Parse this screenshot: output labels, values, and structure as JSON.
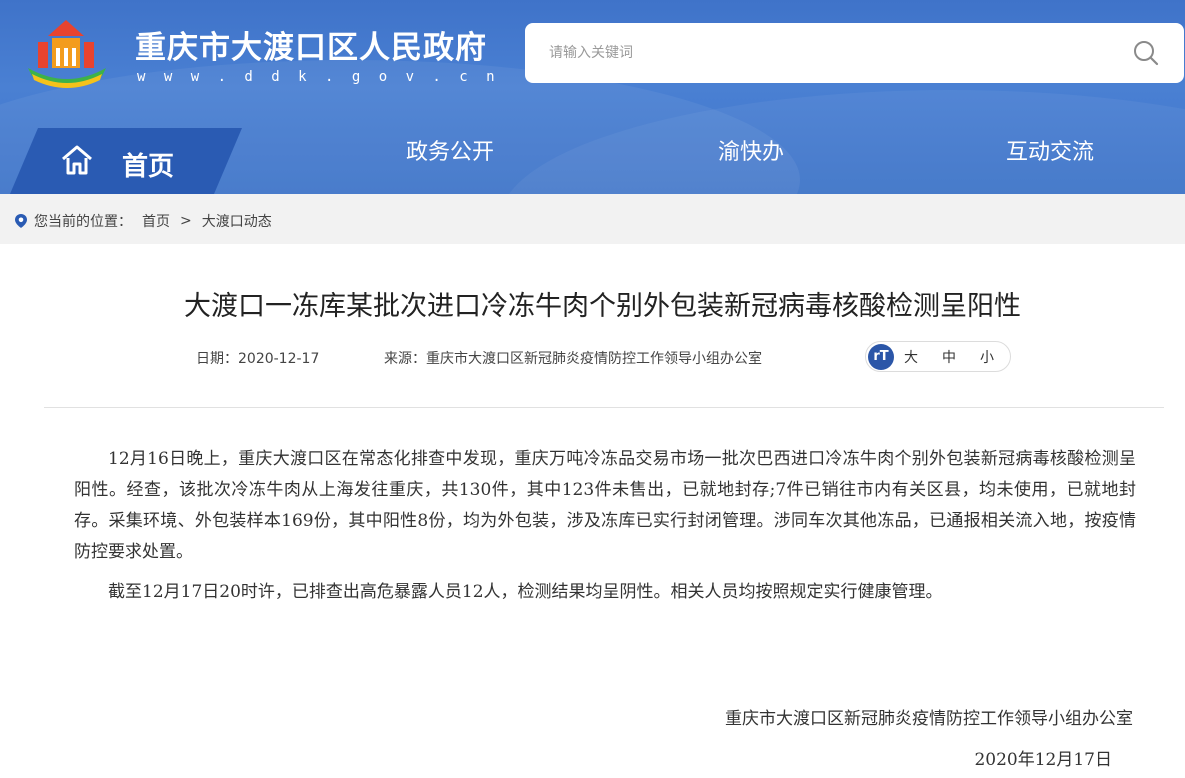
{
  "header": {
    "site_title": "重庆市大渡口区人民政府",
    "site_url": "w w w . d d k . g o v . c n",
    "search_placeholder": "请输入关键词"
  },
  "nav": {
    "home": "首页",
    "items": [
      "政务公开",
      "渝快办",
      "互动交流"
    ]
  },
  "breadcrumb": {
    "prefix": "您当前的位置：",
    "items": [
      "首页",
      ">",
      "大渡口动态"
    ]
  },
  "article": {
    "title": "大渡口一冻库某批次进口冷冻牛肉个别外包装新冠病毒核酸检测呈阳性",
    "date": "日期：2020-12-17",
    "source": "来源：重庆市大渡口区新冠肺炎疫情防控工作领导小组办公室",
    "font_sizes": [
      "大",
      "中",
      "小"
    ],
    "paragraphs": [
      "12月16日晚上，重庆大渡口区在常态化排查中发现，重庆万吨冷冻品交易市场一批次巴西进口冷冻牛肉个别外包装新冠病毒核酸检测呈阳性。经查，该批次冷冻牛肉从上海发往重庆，共130件，其中123件未售出，已就地封存;7件已销往市内有关区县，均未使用，已就地封存。采集环境、外包装样本169份，其中阳性8份，均为外包装，涉及冻库已实行封闭管理。涉同车次其他冻品，已通报相关流入地，按疫情防控要求处置。",
      "截至12月17日20时许，已排查出高危暴露人员12人，检测结果均呈阴性。相关人员均按照规定实行健康管理。"
    ],
    "signature": "重庆市大渡口区新冠肺炎疫情防控工作领导小组办公室",
    "signature_date": "2020年12月17日"
  },
  "colors": {
    "brand_blue": "#3f73c9",
    "tab_blue": "#2a5bb3"
  }
}
